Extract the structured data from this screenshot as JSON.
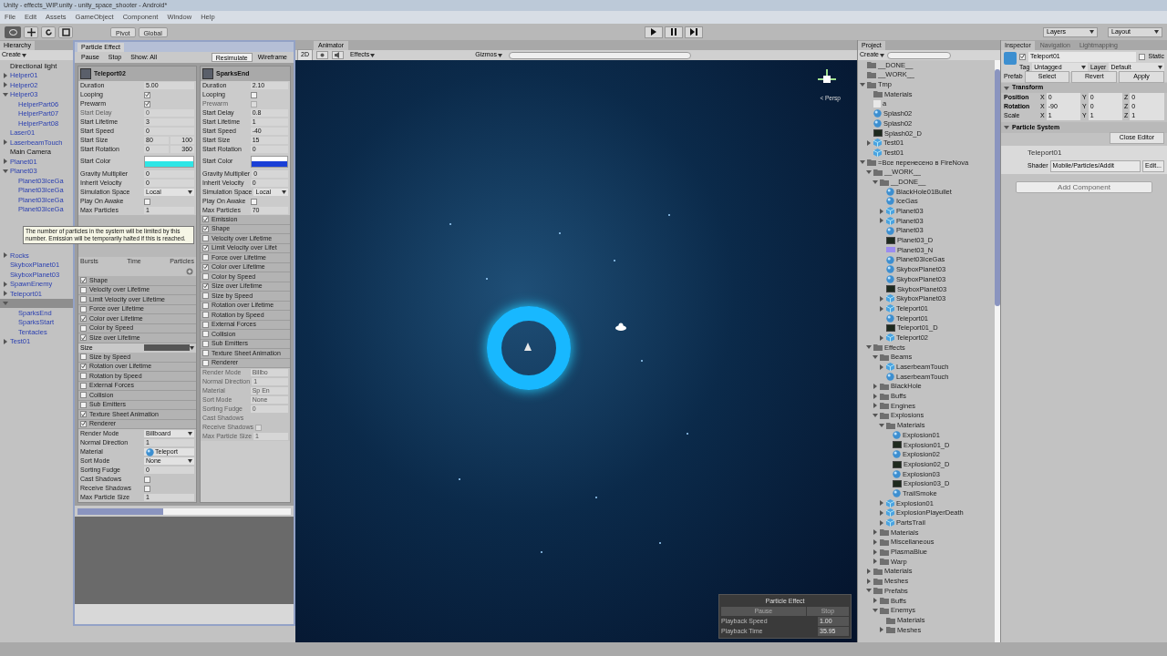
{
  "window": {
    "title": "Unity - effects_WIP.unity - unity_space_shooter - Android*"
  },
  "menu": [
    "File",
    "Edit",
    "Assets",
    "GameObject",
    "Component",
    "Window",
    "Help"
  ],
  "toolbar": {
    "pivot": "Pivot",
    "space": "Global",
    "layers": "Layers",
    "layout": "Layout"
  },
  "hierarchy": {
    "tab": "Hierarchy",
    "create": "Create",
    "items": [
      {
        "label": "Directional light",
        "kind": "object",
        "selected": false
      },
      {
        "label": "Helper01",
        "kind": "prefab",
        "expanded": false,
        "selected": false
      },
      {
        "label": "Helper02",
        "kind": "prefab",
        "expanded": false,
        "selected": false
      },
      {
        "label": "Helper03",
        "kind": "prefab",
        "expanded": true,
        "selected": false,
        "children": [
          {
            "label": "HelperPart06",
            "kind": "prefab",
            "selected": false
          },
          {
            "label": "HelperPart07",
            "kind": "prefab",
            "selected": false
          },
          {
            "label": "HelperPart08",
            "kind": "prefab",
            "selected": false
          }
        ]
      },
      {
        "label": "Laser01",
        "kind": "prefab",
        "selected": false
      },
      {
        "label": "LaserbeamTouch",
        "kind": "prefab",
        "expanded": false,
        "selected": false
      },
      {
        "label": "Main Camera",
        "kind": "object",
        "selected": false
      },
      {
        "label": "Planet01",
        "kind": "prefab",
        "expanded": false,
        "selected": false
      },
      {
        "label": "Planet03",
        "kind": "prefab",
        "expanded": true,
        "selected": false,
        "children": [
          {
            "label": "Planet03IceGa",
            "kind": "prefab",
            "selected": false
          },
          {
            "label": "Planet03IceGa",
            "kind": "prefab",
            "selected": false
          },
          {
            "label": "Planet03IceGa",
            "kind": "prefab",
            "selected": false
          },
          {
            "label": "Planet03IceGa",
            "kind": "prefab",
            "selected": false
          }
        ]
      },
      {
        "kind": "gap"
      },
      {
        "label": "Rocks",
        "kind": "prefab",
        "expanded": false,
        "selected": false
      },
      {
        "label": "SkyboxPlanet01",
        "kind": "prefab",
        "selected": false
      },
      {
        "label": "SkyboxPlanet03",
        "kind": "prefab",
        "selected": false
      },
      {
        "label": "SpawnEnemy",
        "kind": "prefab",
        "expanded": false,
        "selected": false
      },
      {
        "label": "Teleport01",
        "kind": "prefab",
        "expanded": false,
        "selected": false
      },
      {
        "kind": "prefab",
        "expanded": true,
        "selected": true,
        "children": [
          {
            "label": "SparksEnd",
            "kind": "prefab",
            "selected": false
          },
          {
            "label": "SparksStart",
            "kind": "prefab",
            "selected": false
          },
          {
            "label": "Tentacles",
            "kind": "prefab",
            "selected": false
          }
        ]
      },
      {
        "label": "Test01",
        "kind": "prefab",
        "expanded": false,
        "selected": false
      }
    ]
  },
  "particle_effect": {
    "tab": "Particle Effect",
    "toolbar": [
      {
        "label": "Pause",
        "selected": false
      },
      {
        "label": "Stop",
        "selected": false
      },
      {
        "label": "Show: All",
        "selected": false
      },
      {
        "label": "Resimulate",
        "selected": true
      },
      {
        "label": "Wireframe",
        "selected": false
      }
    ],
    "tooltip": "The number of particles in the system will be limited by this number. Emission will be temporarily halted if this is reached.",
    "systems": [
      {
        "name": "Teleport02",
        "bursts": [
          "Bursts",
          "Time",
          "Particles"
        ],
        "properties": [
          {
            "label": "Duration",
            "kind": "number",
            "value": "5.00",
            "disabled": false
          },
          {
            "label": "Looping",
            "kind": "check",
            "checked": true,
            "disabled": false
          },
          {
            "label": "Prewarm",
            "kind": "check",
            "checked": true,
            "disabled": false
          },
          {
            "label": "Start Delay",
            "kind": "number",
            "value": "0",
            "disabled": true
          },
          {
            "label": "Start Lifetime",
            "kind": "number",
            "value": "3",
            "disabled": false
          },
          {
            "label": "Start Speed",
            "kind": "number",
            "value": "0",
            "disabled": false
          },
          {
            "label": "Start Size",
            "kind": "range",
            "value": "80",
            "value2": "100",
            "disabled": false
          },
          {
            "label": "Start Rotation",
            "kind": "range",
            "value": "0",
            "value2": "360",
            "disabled": false
          },
          {
            "label": "Start Color",
            "kind": "gradient",
            "stops": [
              {
                "color": "#ffffff"
              },
              {
                "color": "#2ee6e6"
              }
            ],
            "disabled": false
          },
          {
            "label": "Gravity Multiplier",
            "kind": "number",
            "value": "0",
            "disabled": false
          },
          {
            "label": "Inherit Velocity",
            "kind": "number",
            "value": "0",
            "disabled": false
          },
          {
            "label": "Simulation Space",
            "kind": "dropdown",
            "value": "Local",
            "disabled": false
          },
          {
            "label": "Play On Awake",
            "kind": "check",
            "checked": false,
            "disabled": false
          },
          {
            "label": "Max Particles",
            "kind": "number",
            "value": "1",
            "disabled": false
          }
        ],
        "modules": [
          {
            "label": "Shape",
            "kind": "module",
            "checked": true
          },
          {
            "label": "Velocity over Lifetime",
            "kind": "module",
            "checked": false
          },
          {
            "label": "Limit Velocity over Lifetime",
            "kind": "module",
            "checked": false
          },
          {
            "label": "Force over Lifetime",
            "kind": "module",
            "checked": false
          },
          {
            "label": "Color over Lifetime",
            "kind": "module",
            "checked": true
          },
          {
            "label": "Color by Speed",
            "kind": "module",
            "checked": false
          },
          {
            "label": "Size over Lifetime",
            "kind": "module",
            "checked": true
          },
          {
            "label": "Size",
            "kind": "curve"
          },
          {
            "label": "Size by Speed",
            "kind": "module",
            "checked": false
          },
          {
            "label": "Rotation over Lifetime",
            "kind": "module",
            "checked": true
          },
          {
            "label": "Rotation by Speed",
            "kind": "module",
            "checked": false
          },
          {
            "label": "External Forces",
            "kind": "module",
            "checked": false
          },
          {
            "label": "Collision",
            "kind": "module",
            "checked": false
          },
          {
            "label": "Sub Emitters",
            "kind": "module",
            "checked": false
          },
          {
            "label": "Texture Sheet Animation",
            "kind": "module",
            "checked": true
          },
          {
            "label": "Renderer",
            "kind": "module",
            "checked": true
          }
        ],
        "renderer": [
          {
            "label": "Render Mode",
            "kind": "dropdown",
            "value": "Billboard",
            "disabled": false
          },
          {
            "label": "Normal Direction",
            "kind": "number",
            "value": "1",
            "disabled": false
          },
          {
            "label": "Material",
            "kind": "object",
            "value": "Teleport",
            "disabled": false
          },
          {
            "label": "Sort Mode",
            "kind": "dropdown",
            "value": "None",
            "disabled": false
          },
          {
            "label": "Sorting Fudge",
            "kind": "number",
            "value": "0",
            "disabled": false
          },
          {
            "label": "Cast Shadows",
            "kind": "check",
            "checked": false,
            "disabled": false
          },
          {
            "label": "Receive Shadows",
            "kind": "check",
            "checked": false,
            "disabled": false
          },
          {
            "label": "Max Particle Size",
            "kind": "number",
            "value": "1",
            "disabled": false
          }
        ]
      },
      {
        "name": "SparksEnd",
        "properties": [
          {
            "label": "Duration",
            "kind": "number",
            "value": "2.10",
            "disabled": false
          },
          {
            "label": "Looping",
            "kind": "check",
            "checked": false,
            "disabled": false
          },
          {
            "label": "Prewarm",
            "kind": "check",
            "checked": false,
            "disabled": true
          },
          {
            "label": "Start Delay",
            "kind": "number",
            "value": "0.8",
            "disabled": false
          },
          {
            "label": "Start Lifetime",
            "kind": "number",
            "value": "1",
            "disabled": false
          },
          {
            "label": "Start Speed",
            "kind": "number",
            "value": "-40",
            "disabled": false
          },
          {
            "label": "Start Size",
            "kind": "number",
            "value": "15",
            "disabled": false
          },
          {
            "label": "Start Rotation",
            "kind": "number",
            "value": "0",
            "disabled": false
          },
          {
            "label": "Start Color",
            "kind": "gradient",
            "stops": [
              {
                "color": "#ffffff"
              },
              {
                "color": "#1a3fd6"
              }
            ],
            "disabled": false
          },
          {
            "label": "Gravity Multiplier",
            "kind": "number",
            "value": "0",
            "disabled": false
          },
          {
            "label": "Inherit Velocity",
            "kind": "number",
            "value": "0",
            "disabled": false
          },
          {
            "label": "Simulation Space",
            "kind": "dropdown",
            "value": "Local",
            "disabled": false
          },
          {
            "label": "Play On Awake",
            "kind": "check",
            "checked": false,
            "disabled": false
          },
          {
            "label": "Max Particles",
            "kind": "number",
            "value": "70",
            "disabled": false
          }
        ],
        "modules": [
          {
            "label": "Emission",
            "kind": "module",
            "checked": true
          },
          {
            "label": "Shape",
            "kind": "module",
            "checked": true
          },
          {
            "label": "Velocity over Lifetime",
            "kind": "module",
            "checked": false
          },
          {
            "label": "Limit Velocity over Lifet",
            "kind": "module",
            "checked": true
          },
          {
            "label": "Force over Lifetime",
            "kind": "module",
            "checked": false
          },
          {
            "label": "Color over Lifetime",
            "kind": "module",
            "checked": true
          },
          {
            "label": "Color by Speed",
            "kind": "module",
            "checked": false
          },
          {
            "label": "Size over Lifetime",
            "kind": "module",
            "checked": true
          },
          {
            "label": "Size by Speed",
            "kind": "module",
            "checked": false
          },
          {
            "label": "Rotation over Lifetime",
            "kind": "module",
            "checked": false
          },
          {
            "label": "Rotation by Speed",
            "kind": "module",
            "checked": false
          },
          {
            "label": "External Forces",
            "kind": "module",
            "checked": false
          },
          {
            "label": "Collision",
            "kind": "module",
            "checked": false
          },
          {
            "label": "Sub Emitters",
            "kind": "module",
            "checked": false
          },
          {
            "label": "Texture Sheet Animation",
            "kind": "module",
            "checked": false
          },
          {
            "label": "Renderer",
            "kind": "module",
            "checked": false
          }
        ],
        "renderer": [
          {
            "label": "Render Mode",
            "kind": "number",
            "value": "Billbo",
            "disabled": true
          },
          {
            "label": "Normal Direction",
            "kind": "number",
            "value": "1",
            "disabled": true
          },
          {
            "label": "Material",
            "kind": "number",
            "value": "Sp En",
            "disabled": true
          },
          {
            "label": "Sort Mode",
            "kind": "number",
            "value": "None",
            "disabled": true
          },
          {
            "label": "Sorting Fudge",
            "kind": "number",
            "value": "0",
            "disabled": true
          },
          {
            "label": "Cast Shadows",
            "kind": "number",
            "disabled": true
          },
          {
            "label": "Receive Shadows",
            "kind": "check",
            "checked": false,
            "disabled": true
          },
          {
            "label": "Max Particle Size",
            "kind": "number",
            "value": "1",
            "disabled": true
          }
        ]
      }
    ]
  },
  "scene": {
    "tab": "Animator",
    "mode": "2D",
    "effects": "Effects",
    "gizmos": "Gizmos",
    "persp": "< Persp",
    "overlay": {
      "title": "Particle Effect",
      "buttons": [
        "Pause",
        "Stop"
      ],
      "rows": [
        {
          "label": "Playback Speed",
          "value": "1.00"
        },
        {
          "label": "Playback Time",
          "value": "35.95"
        }
      ]
    }
  },
  "project": {
    "tab": "Project",
    "create": "Create",
    "items": [
      {
        "label": "__DONE__",
        "kind": "folder"
      },
      {
        "label": "__WORK__",
        "kind": "folder"
      },
      {
        "label": "Tmp",
        "kind": "folder",
        "expanded": true,
        "children": [
          {
            "label": "Materials",
            "kind": "folder"
          },
          {
            "label": "a",
            "kind": "file"
          },
          {
            "label": "Splash02",
            "kind": "material"
          },
          {
            "label": "Splash02",
            "kind": "material"
          },
          {
            "label": "Splash02_D",
            "kind": "texture"
          },
          {
            "label": "Test01",
            "kind": "prefab",
            "expanded": false
          },
          {
            "label": "Test01",
            "kind": "prefab"
          }
        ]
      },
      {
        "label": "=Все перенесено в FireNova",
        "kind": "folder",
        "expanded": true,
        "children": [
          {
            "label": "__WORK__",
            "kind": "folder",
            "expanded": true,
            "children": [
              {
                "label": "__DONE__",
                "kind": "folder",
                "expanded": true,
                "children": [
                  {
                    "label": "BlackHole01Bullet",
                    "kind": "material"
                  },
                  {
                    "label": "IceGas",
                    "kind": "material"
                  },
                  {
                    "label": "Planet03",
                    "kind": "prefab",
                    "expanded": false
                  },
                  {
                    "label": "Planet03",
                    "kind": "prefab",
                    "expanded": false
                  },
                  {
                    "label": "Planet03",
                    "kind": "material"
                  },
                  {
                    "label": "Planet03_D",
                    "kind": "texture"
                  },
                  {
                    "label": "Planet03_N",
                    "kind": "normalmap"
                  },
                  {
                    "label": "Planet03IceGas",
                    "kind": "material"
                  },
                  {
                    "label": "SkyboxPlanet03",
                    "kind": "material"
                  },
                  {
                    "label": "SkyboxPlanet03",
                    "kind": "material"
                  },
                  {
                    "label": "SkyboxPlanet03",
                    "kind": "texture"
                  },
                  {
                    "label": "SkyboxPlanet03",
                    "kind": "prefab",
                    "expanded": false
                  },
                  {
                    "label": "Teleport01",
                    "kind": "prefab",
                    "expanded": false
                  },
                  {
                    "label": "Teleport01",
                    "kind": "material"
                  },
                  {
                    "label": "Teleport01_D",
                    "kind": "texture"
                  },
                  {
                    "label": "Teleport02",
                    "kind": "prefab",
                    "expanded": false
                  }
                ]
              }
            ]
          },
          {
            "label": "Effects",
            "kind": "folder",
            "expanded": true,
            "children": [
              {
                "label": "Beams",
                "kind": "folder",
                "expanded": true,
                "children": [
                  {
                    "label": "LaserbeamTouch",
                    "kind": "prefab",
                    "expanded": false
                  },
                  {
                    "label": "LaserbeamTouch",
                    "kind": "material"
                  }
                ]
              },
              {
                "label": "BlackHole",
                "kind": "folder",
                "expanded": false
              },
              {
                "label": "Buffs",
                "kind": "folder",
                "expanded": false
              },
              {
                "label": "Engines",
                "kind": "folder",
                "expanded": false
              },
              {
                "label": "Explosions",
                "kind": "folder",
                "expanded": true,
                "children": [
                  {
                    "label": "Materials",
                    "kind": "folder",
                    "expanded": true,
                    "children": [
                      {
                        "label": "Explosion01",
                        "kind": "material"
                      },
                      {
                        "label": "Explosion01_D",
                        "kind": "texture"
                      },
                      {
                        "label": "Explosion02",
                        "kind": "material"
                      },
                      {
                        "label": "Explosion02_D",
                        "kind": "texture"
                      },
                      {
                        "label": "Explosion03",
                        "kind": "material"
                      },
                      {
                        "label": "Explosion03_D",
                        "kind": "texture"
                      },
                      {
                        "label": "TrailSmoke",
                        "kind": "material"
                      }
                    ]
                  },
                  {
                    "label": "Explosion01",
                    "kind": "prefab",
                    "expanded": false
                  },
                  {
                    "label": "ExplosionPlayerDeath",
                    "kind": "prefab",
                    "expanded": false
                  },
                  {
                    "label": "PartsTrail",
                    "kind": "prefab",
                    "expanded": false
                  }
                ]
              },
              {
                "label": "Materials",
                "kind": "folder",
                "expanded": false
              },
              {
                "label": "Miscellaneous",
                "kind": "folder",
                "expanded": false
              },
              {
                "label": "PlasmaBlue",
                "kind": "folder",
                "expanded": false
              },
              {
                "label": "Warp",
                "kind": "folder",
                "expanded": false
              }
            ]
          },
          {
            "label": "Materials",
            "kind": "folder",
            "expanded": false
          },
          {
            "label": "Meshes",
            "kind": "folder",
            "expanded": false
          },
          {
            "label": "Prefabs",
            "kind": "folder",
            "expanded": true,
            "children": [
              {
                "label": "Buffs",
                "kind": "folder",
                "expanded": false
              },
              {
                "label": "Enemys",
                "kind": "folder",
                "expanded": true,
                "children": [
                  {
                    "label": "Materials",
                    "kind": "folder"
                  },
                  {
                    "label": "Meshes",
                    "kind": "folder",
                    "expanded": false
                  }
                ]
              }
            ]
          }
        ]
      }
    ]
  },
  "inspector": {
    "tabs": [
      {
        "label": "Inspector",
        "selected": true
      },
      {
        "label": "Navigation",
        "selected": false
      },
      {
        "label": "Lightmapping",
        "selected": false
      }
    ],
    "name": "Teleport01",
    "active": true,
    "static_label": "Static",
    "static": false,
    "tag_label": "Tag",
    "tag": "Untagged",
    "layer_label": "Layer",
    "layer": "Default",
    "prefab_label": "Prefab",
    "prefab_buttons": [
      "Select",
      "Revert",
      "Apply"
    ],
    "transform": {
      "title": "Transform",
      "rows": [
        {
          "label": "Position",
          "bold": true,
          "values": [
            [
              "X",
              "0"
            ],
            [
              "Y",
              "0"
            ],
            [
              "Z",
              "0"
            ]
          ]
        },
        {
          "label": "Rotation",
          "bold": true,
          "values": [
            [
              "X",
              "-90"
            ],
            [
              "Y",
              "0"
            ],
            [
              "Z",
              "0"
            ]
          ]
        },
        {
          "label": "Scale",
          "bold": false,
          "values": [
            [
              "X",
              "1"
            ],
            [
              "Y",
              "1"
            ],
            [
              "Z",
              "1"
            ]
          ]
        }
      ]
    },
    "particle_system": {
      "title": "Particle System",
      "button": "Close Editor"
    },
    "material": {
      "name": "Teleport01",
      "shader_label": "Shader",
      "shader": "Mobile/Particles/Addit",
      "edit": "Edit..."
    },
    "add_component": "Add Component"
  }
}
